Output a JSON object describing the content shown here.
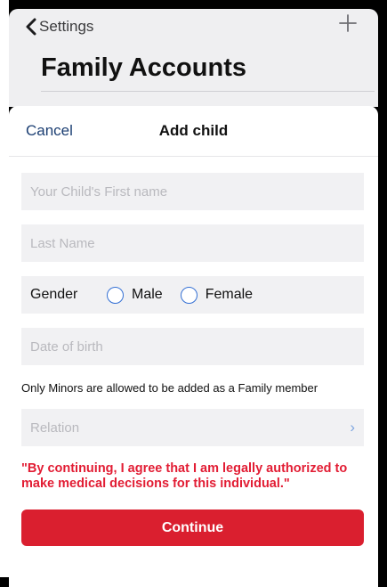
{
  "background_screen": {
    "back_label": "Settings",
    "title": "Family Accounts",
    "icons": {
      "back": "chevron-left-icon",
      "add": "plus-icon"
    }
  },
  "sheet": {
    "cancel_label": "Cancel",
    "title": "Add child",
    "first_name_placeholder": "Your Child's First name",
    "last_name_placeholder": "Last Name",
    "gender": {
      "label": "Gender",
      "options": [
        "Male",
        "Female"
      ],
      "selected": null
    },
    "dob_placeholder": "Date of birth",
    "minors_note": "Only Minors are allowed to be added as a Family member",
    "relation_placeholder": "Relation",
    "consent_text": "\"By continuing, I agree that I am legally authorized to make medical decisions for this individual.\"",
    "continue_label": "Continue"
  },
  "colors": {
    "accent_red": "#da1f2f",
    "consent_red": "#e21d34",
    "cancel_blue": "#1c3f73",
    "radio_blue": "#3470d4",
    "field_bg": "#f1f1f3"
  }
}
